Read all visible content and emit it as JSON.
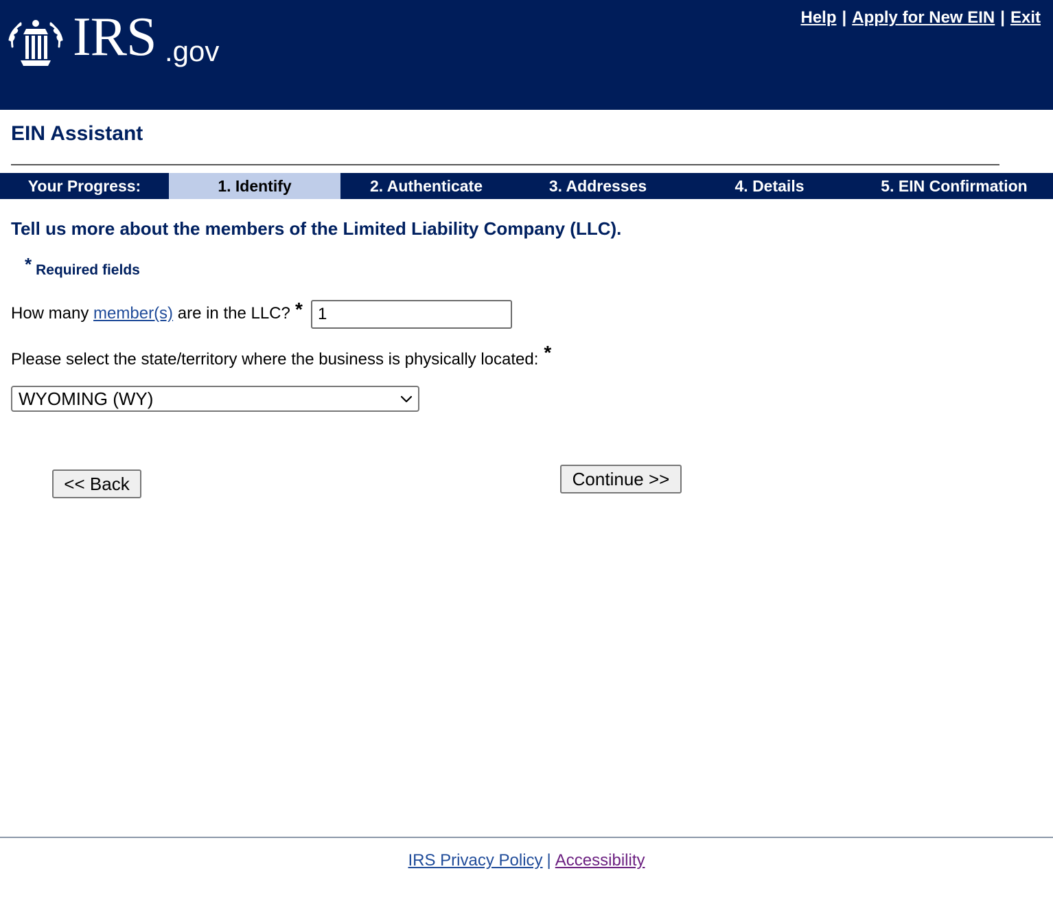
{
  "header": {
    "logo_text": "IRS",
    "logo_suffix": ".gov",
    "links": {
      "help": "Help",
      "apply": "Apply for New EIN",
      "exit": "Exit",
      "separator": "|"
    }
  },
  "app_title": "EIN Assistant",
  "progress": {
    "label": "Your Progress:",
    "steps": [
      "1. Identify",
      "2. Authenticate",
      "3. Addresses",
      "4. Details",
      "5. EIN Confirmation"
    ],
    "active_step": "1. Identify"
  },
  "form": {
    "question": "Tell us more about the members of the Limited Liability Company (LLC).",
    "required_marker": "*",
    "required_label": "Required fields",
    "members_prefix": "How many",
    "members_link": "member(s)",
    "members_suffix": "are in the LLC?",
    "members_value": "1",
    "state_label": "Please select the state/territory where the business is physically located:",
    "state_value": "WYOMING (WY)"
  },
  "buttons": {
    "back": "<< Back",
    "continue": "Continue >>"
  },
  "footer": {
    "privacy": "IRS Privacy Policy",
    "separator": "|",
    "accessibility": "Accessibility"
  },
  "colors": {
    "header_bg": "#001d5a",
    "title_blue": "#002060",
    "active_step_bg": "#bfcde9",
    "link_blue": "#1f4b99",
    "visited_purple": "#6b1f80"
  },
  "icons": [
    "irs-eagle-logo-icon",
    "chevron-down-icon"
  ]
}
